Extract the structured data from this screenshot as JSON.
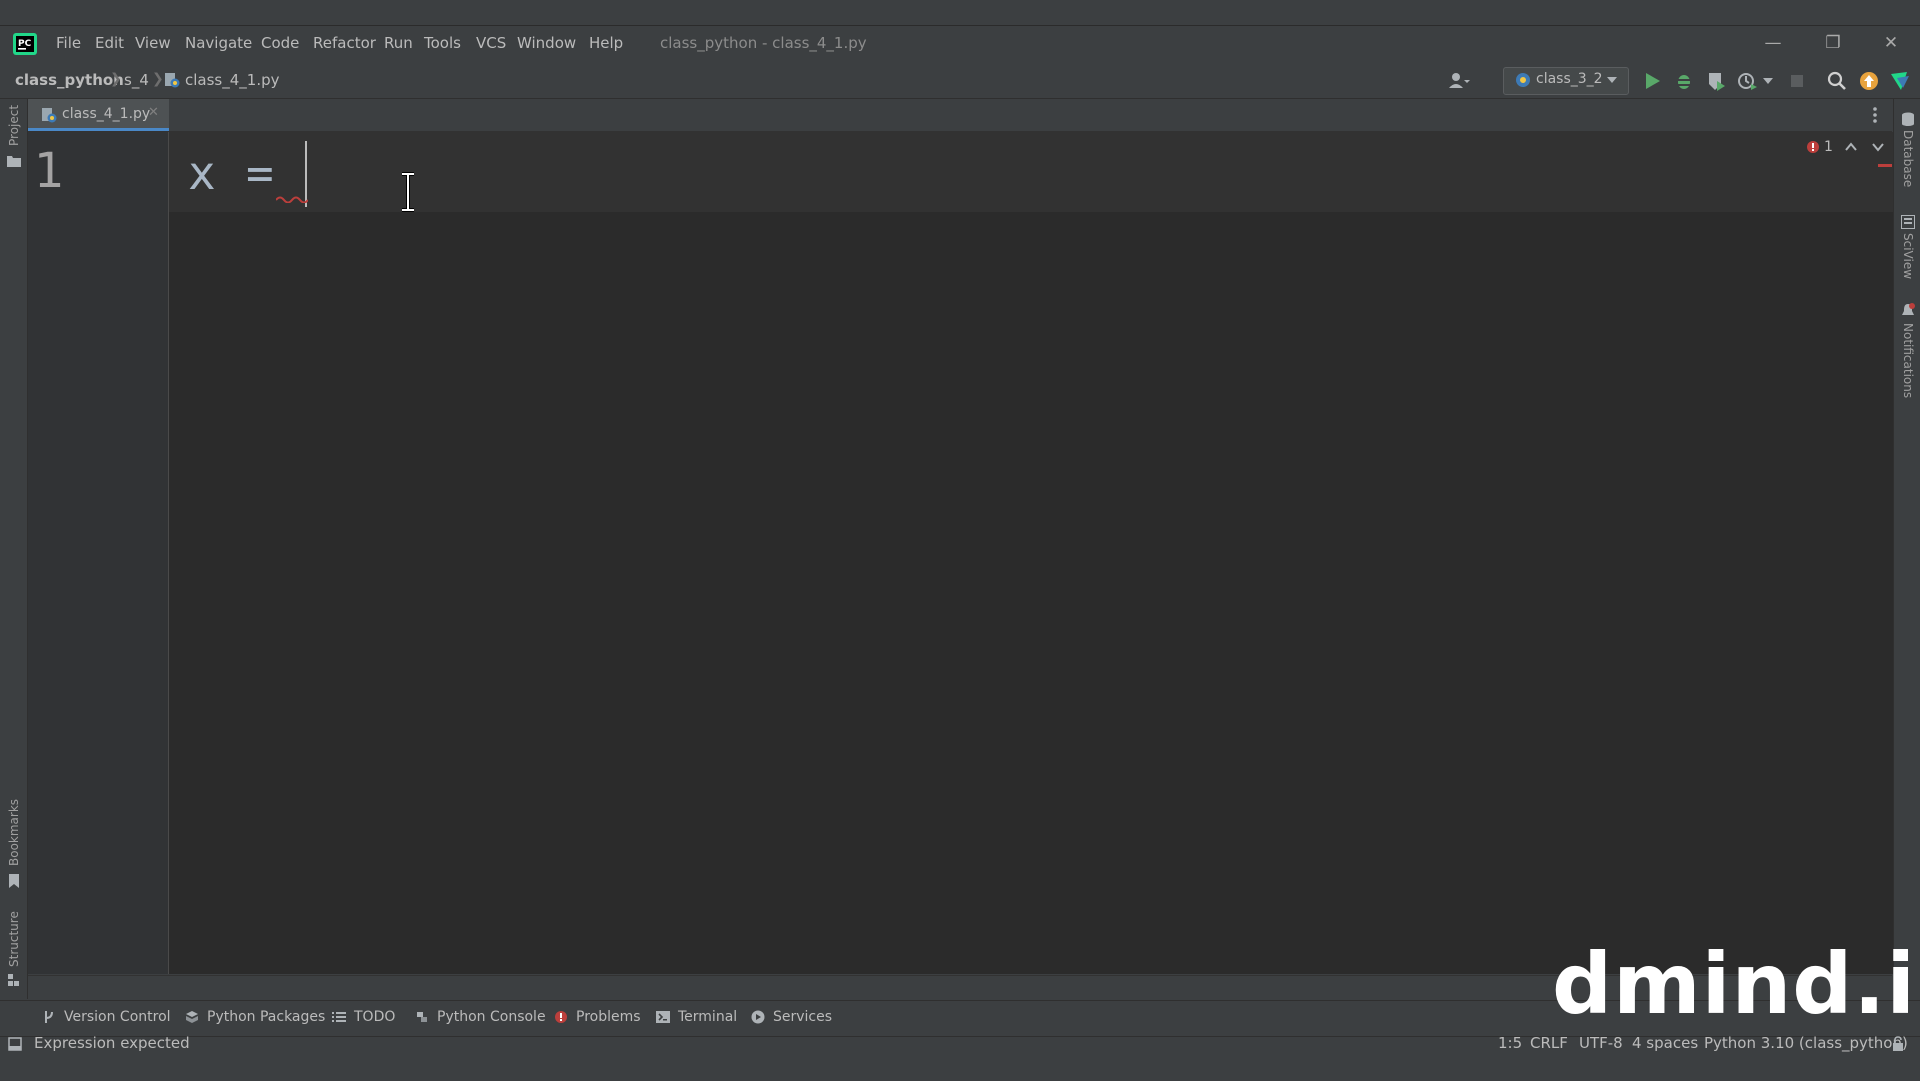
{
  "menu": {
    "items": [
      "File",
      "Edit",
      "View",
      "Navigate",
      "Code",
      "Refactor",
      "Run",
      "Tools",
      "VCS",
      "Window",
      "Help"
    ]
  },
  "window": {
    "title": "class_python - class_4_1.py"
  },
  "breadcrumb": {
    "project": "class_python",
    "folder": "s_4",
    "file": "class_4_1.py"
  },
  "toolbar": {
    "run_config": "class_3_2"
  },
  "editor": {
    "tab_label": "class_4_1.py",
    "line_number": "1",
    "code_identifier": "x",
    "code_operator": "=",
    "error_count": "1"
  },
  "left_stripe": {
    "project_label": "Project",
    "bookmarks_label": "Bookmarks",
    "structure_label": "Structure"
  },
  "right_stripe": {
    "database_label": "Database",
    "sciview_label": "SciView",
    "notifications_label": "Notifications"
  },
  "bottom_tabs": [
    {
      "label": "Version Control",
      "icon": "branch-icon"
    },
    {
      "label": "Python Packages",
      "icon": "packages-icon"
    },
    {
      "label": "TODO",
      "icon": "list-icon"
    },
    {
      "label": "Python Console",
      "icon": "python-icon"
    },
    {
      "label": "Problems",
      "icon": "error-icon"
    },
    {
      "label": "Terminal",
      "icon": "terminal-icon"
    },
    {
      "label": "Services",
      "icon": "services-icon"
    }
  ],
  "status": {
    "message": "Expression expected",
    "position": "1:5",
    "line_separator": "CRLF",
    "encoding": "UTF-8",
    "indent": "4 spaces",
    "interpreter": "Python 3.10 (class_python)"
  },
  "watermark": "dmind.ir",
  "colors": {
    "error": "#bc3f3c",
    "run_green": "#59a869",
    "accent_blue": "#4a88c7"
  }
}
